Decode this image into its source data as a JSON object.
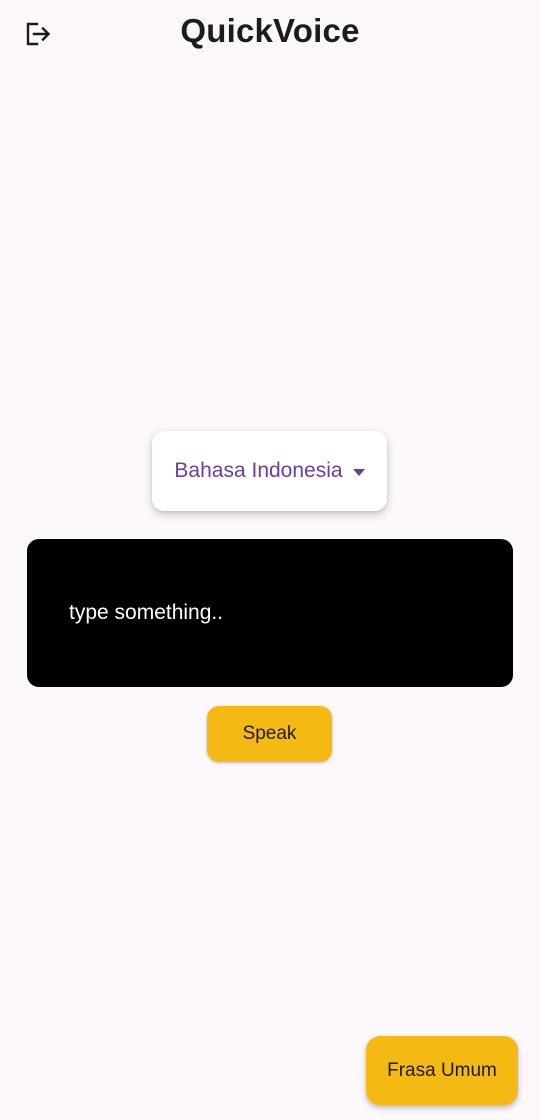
{
  "app_bar": {
    "title": "QuickVoice",
    "logout_icon": "logout-icon"
  },
  "language": {
    "selected": "Bahasa Indonesia",
    "dropdown_icon": "caret-down-icon",
    "accent_color": "#6a3ea1"
  },
  "text_input": {
    "placeholder": "type something.."
  },
  "actions": {
    "speak_label": "Speak",
    "phrases_label": "Frasa Umum",
    "button_color": "#f5b914"
  }
}
